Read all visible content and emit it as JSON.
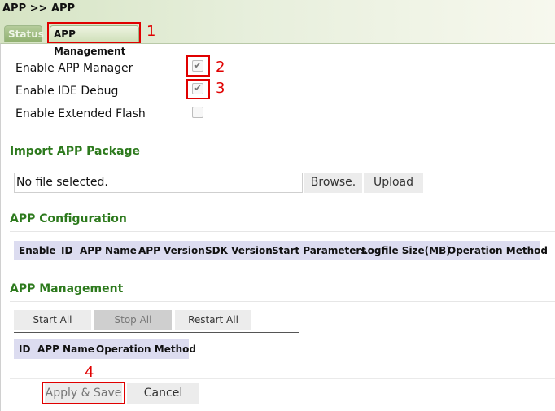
{
  "breadcrumb": "APP >> APP",
  "tabs": {
    "status": "Status",
    "app_management": "APP Management"
  },
  "callouts": {
    "n1": "1",
    "n2": "2",
    "n3": "3",
    "n4": "4"
  },
  "settings": {
    "enable_app_manager": {
      "label": "Enable APP Manager",
      "checked": true
    },
    "enable_ide_debug": {
      "label": "Enable IDE Debug",
      "checked": true
    },
    "enable_extended_flash": {
      "label": "Enable Extended Flash",
      "checked": false
    }
  },
  "import": {
    "title": "Import APP Package",
    "file_text": "No file selected.",
    "browse_label": "Browse.",
    "upload_label": "Upload"
  },
  "config": {
    "title": "APP Configuration",
    "columns": [
      "Enable",
      "ID",
      "APP Name",
      "APP Version",
      "SDK Version",
      "Start Parameters",
      "Logfile Size(MB)",
      "Operation Method"
    ]
  },
  "management": {
    "title": "APP Management",
    "start_all": "Start All",
    "stop_all": "Stop All",
    "restart_all": "Restart All",
    "columns": [
      "ID",
      "APP Name",
      "Operation Method"
    ]
  },
  "footer": {
    "apply_label": "Apply & Save",
    "cancel_label": "Cancel"
  },
  "colors": {
    "section_title": "#2d7a1d",
    "callout": "#e00000",
    "table_header": "#dcdcf0"
  },
  "icons": {
    "checked": "check-mark"
  }
}
